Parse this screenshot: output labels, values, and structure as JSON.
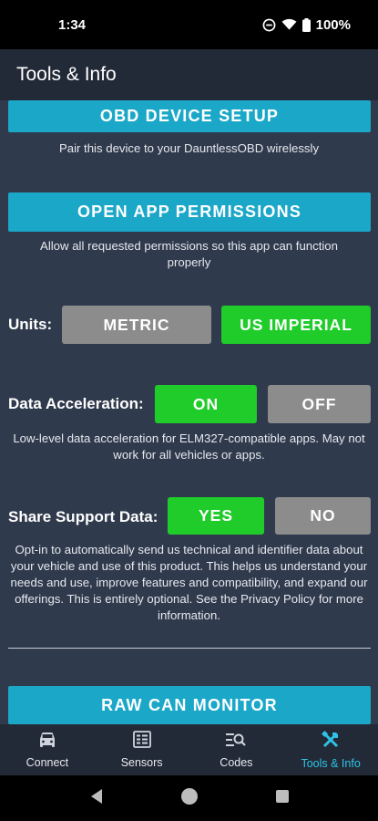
{
  "status_bar": {
    "time": "1:34",
    "battery": "100%"
  },
  "app_bar": {
    "title": "Tools & Info"
  },
  "sections": {
    "obd_setup": {
      "button_label": "OBD DEVICE SETUP",
      "description": "Pair this device to your DauntlessOBD wirelessly"
    },
    "permissions": {
      "button_label": "OPEN APP PERMISSIONS",
      "description": "Allow all requested permissions so this app can function properly"
    },
    "units": {
      "label": "Units:",
      "option_metric": "METRIC",
      "option_imperial": "US IMPERIAL",
      "selected": "US IMPERIAL"
    },
    "data_acceleration": {
      "label": "Data Acceleration:",
      "option_on": "ON",
      "option_off": "OFF",
      "selected": "ON",
      "description": "Low-level data acceleration for ELM327-compatible apps. May not work for all vehicles or apps."
    },
    "share_support": {
      "label": "Share Support Data:",
      "option_yes": "YES",
      "option_no": "NO",
      "selected": "YES",
      "description": "Opt-in to automatically send us technical and identifier data about your vehicle and use of this product. This helps us understand your needs and use, improve features and compatibility, and expand our offerings. This is entirely optional. See the Privacy Policy for more information."
    },
    "raw_can": {
      "button_label": "RAW CAN MONITOR"
    }
  },
  "bottom_nav": {
    "items": [
      {
        "label": "Connect",
        "icon": "car-icon"
      },
      {
        "label": "Sensors",
        "icon": "sensors-grid-icon"
      },
      {
        "label": "Codes",
        "icon": "codes-search-icon"
      },
      {
        "label": "Tools & Info",
        "icon": "tools-icon"
      }
    ],
    "active": "Tools & Info"
  },
  "colors": {
    "accent": "#1ba7c8",
    "active_toggle": "#1fcc2a",
    "inactive_toggle": "#8c8c8c",
    "background": "#303a4d",
    "bar": "#232a37",
    "nav_active": "#2ec3e6"
  }
}
